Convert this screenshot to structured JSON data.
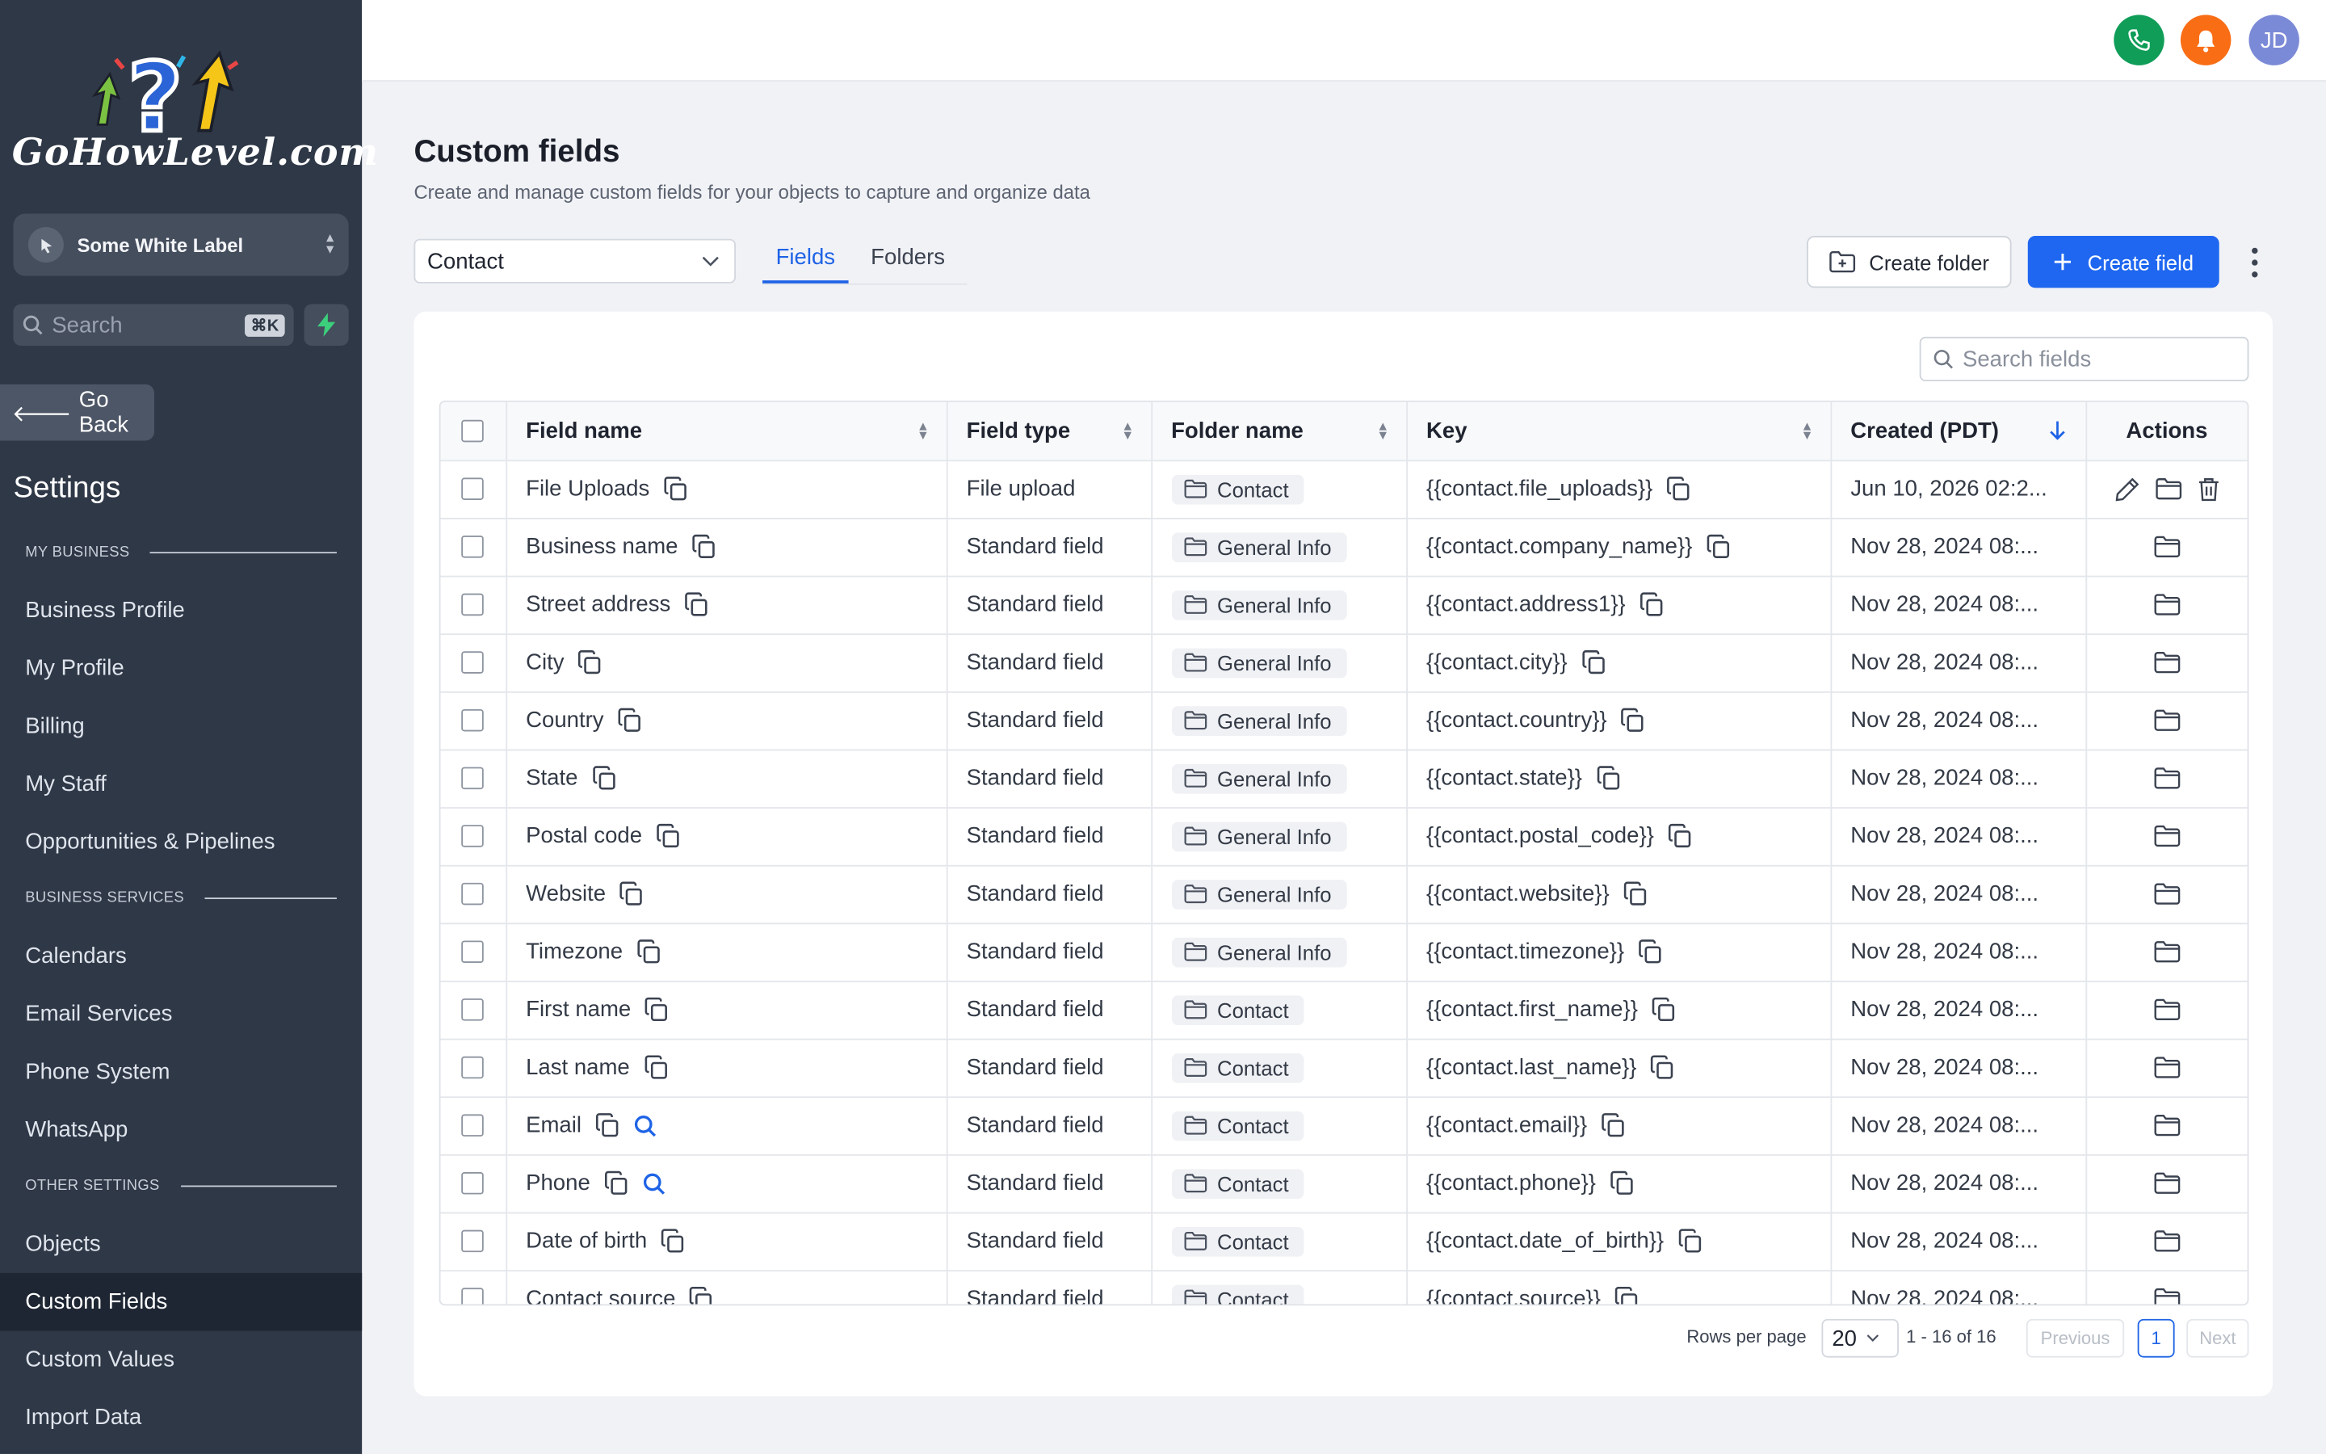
{
  "brand": {
    "logo_text": "GoHowLevel.com"
  },
  "sidebar": {
    "account_name": "Some White Label",
    "search_placeholder": "Search",
    "search_shortcut": "⌘K",
    "go_back": "Go Back",
    "settings_title": "Settings",
    "sections": [
      {
        "title": "MY BUSINESS",
        "items": [
          "Business Profile",
          "My Profile",
          "Billing",
          "My Staff",
          "Opportunities & Pipelines"
        ]
      },
      {
        "title": "BUSINESS SERVICES",
        "items": [
          "Calendars",
          "Email Services",
          "Phone System",
          "WhatsApp"
        ]
      },
      {
        "title": "OTHER SETTINGS",
        "items": [
          "Objects",
          "Custom Fields",
          "Custom Values",
          "Import Data"
        ]
      }
    ],
    "active_item": "Custom Fields"
  },
  "header": {
    "avatar_initials": "JD",
    "phone_color": "#0f9d58",
    "bell_color": "#f96d15",
    "avatar_color": "#7b8ad6"
  },
  "page": {
    "title": "Custom fields",
    "subtitle": "Create and manage custom fields for your objects to capture and organize data",
    "object_selected": "Contact",
    "tabs": [
      "Fields",
      "Folders"
    ],
    "active_tab": "Fields",
    "create_folder": "Create folder",
    "create_field": "Create field",
    "search_placeholder": "Search fields"
  },
  "table": {
    "headers": {
      "field_name": "Field name",
      "field_type": "Field type",
      "folder_name": "Folder name",
      "key": "Key",
      "created": "Created (PDT)",
      "actions": "Actions"
    },
    "rows": [
      {
        "name": "File Uploads",
        "type": "File upload",
        "folder": "Contact",
        "key": "{{contact.file_uploads}}",
        "created": "Jun 10, 2026 02:2...",
        "editable": true,
        "searchable": false
      },
      {
        "name": "Business name",
        "type": "Standard field",
        "folder": "General Info",
        "key": "{{contact.company_name}}",
        "created": "Nov 28, 2024 08:...",
        "editable": false,
        "searchable": false
      },
      {
        "name": "Street address",
        "type": "Standard field",
        "folder": "General Info",
        "key": "{{contact.address1}}",
        "created": "Nov 28, 2024 08:...",
        "editable": false,
        "searchable": false
      },
      {
        "name": "City",
        "type": "Standard field",
        "folder": "General Info",
        "key": "{{contact.city}}",
        "created": "Nov 28, 2024 08:...",
        "editable": false,
        "searchable": false
      },
      {
        "name": "Country",
        "type": "Standard field",
        "folder": "General Info",
        "key": "{{contact.country}}",
        "created": "Nov 28, 2024 08:...",
        "editable": false,
        "searchable": false
      },
      {
        "name": "State",
        "type": "Standard field",
        "folder": "General Info",
        "key": "{{contact.state}}",
        "created": "Nov 28, 2024 08:...",
        "editable": false,
        "searchable": false
      },
      {
        "name": "Postal code",
        "type": "Standard field",
        "folder": "General Info",
        "key": "{{contact.postal_code}}",
        "created": "Nov 28, 2024 08:...",
        "editable": false,
        "searchable": false
      },
      {
        "name": "Website",
        "type": "Standard field",
        "folder": "General Info",
        "key": "{{contact.website}}",
        "created": "Nov 28, 2024 08:...",
        "editable": false,
        "searchable": false
      },
      {
        "name": "Timezone",
        "type": "Standard field",
        "folder": "General Info",
        "key": "{{contact.timezone}}",
        "created": "Nov 28, 2024 08:...",
        "editable": false,
        "searchable": false
      },
      {
        "name": "First name",
        "type": "Standard field",
        "folder": "Contact",
        "key": "{{contact.first_name}}",
        "created": "Nov 28, 2024 08:...",
        "editable": false,
        "searchable": false
      },
      {
        "name": "Last name",
        "type": "Standard field",
        "folder": "Contact",
        "key": "{{contact.last_name}}",
        "created": "Nov 28, 2024 08:...",
        "editable": false,
        "searchable": false
      },
      {
        "name": "Email",
        "type": "Standard field",
        "folder": "Contact",
        "key": "{{contact.email}}",
        "created": "Nov 28, 2024 08:...",
        "editable": false,
        "searchable": true
      },
      {
        "name": "Phone",
        "type": "Standard field",
        "folder": "Contact",
        "key": "{{contact.phone}}",
        "created": "Nov 28, 2024 08:...",
        "editable": false,
        "searchable": true
      },
      {
        "name": "Date of birth",
        "type": "Standard field",
        "folder": "Contact",
        "key": "{{contact.date_of_birth}}",
        "created": "Nov 28, 2024 08:...",
        "editable": false,
        "searchable": false
      },
      {
        "name": "Contact source",
        "type": "Standard field",
        "folder": "Contact",
        "key": "{{contact.source}}",
        "created": "Nov 28, 2024 08:...",
        "editable": false,
        "searchable": false
      }
    ]
  },
  "pagination": {
    "rows_per_page_label": "Rows per page",
    "rows_per_page": "20",
    "range": "1 - 16 of 16",
    "previous": "Previous",
    "current_page": "1",
    "next": "Next"
  }
}
